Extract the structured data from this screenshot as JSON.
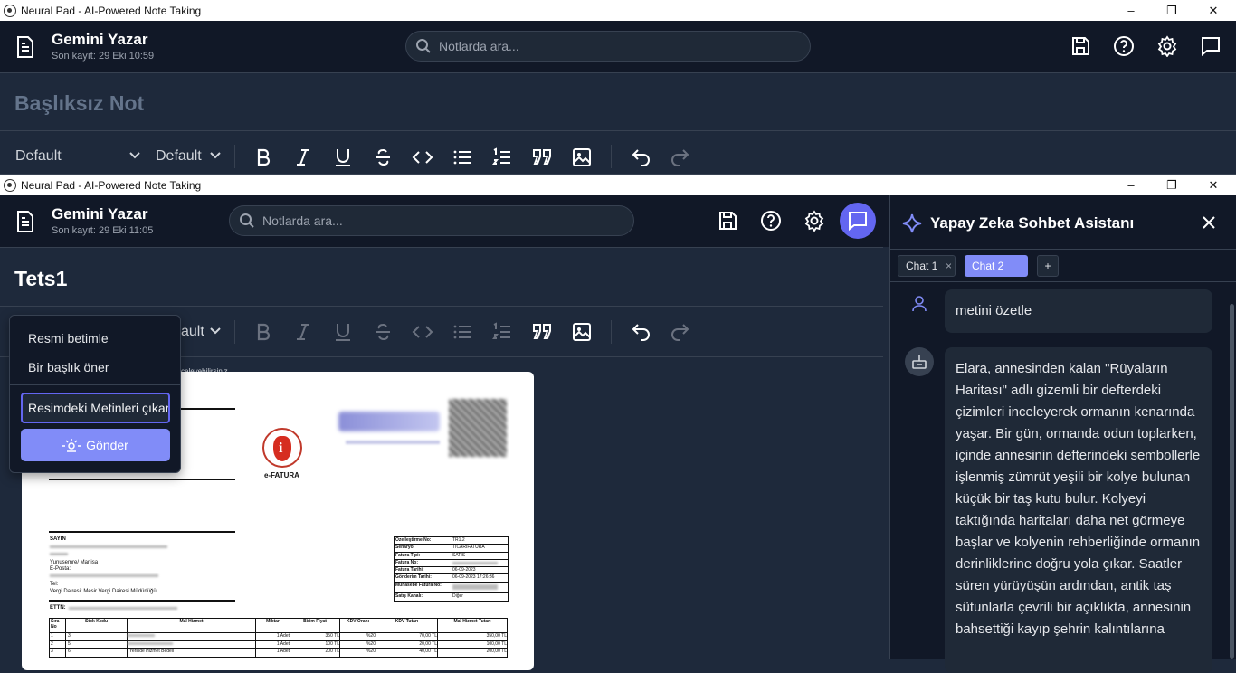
{
  "window": {
    "title": "Neural Pad - AI-Powered Note Taking"
  },
  "back_window": {
    "app_name": "Gemini Yazar",
    "saved": "Son kayıt: 29 Eki 10:59",
    "search_placeholder": "Notlarda ara...",
    "note_title": "Başlıksız Not",
    "font_family": "Default",
    "font_size": "Default"
  },
  "front_window": {
    "app_name": "Gemini Yazar",
    "saved": "Son kayıt: 29 Eki 11:05",
    "search_placeholder": "Notlarda ara...",
    "note_title": "Tets1",
    "font_size_partial": "ault",
    "editor_partial_text": "celeyebilirsiniz."
  },
  "ai_popup": {
    "items": [
      "Resmi betimle",
      "Bir başlık öner"
    ],
    "input_value": "Resimdeki Metinleri çıkar",
    "send_label": "Gönder"
  },
  "chat": {
    "title": "Yapay Zeka Sohbet Asistanı",
    "tabs": [
      {
        "label": "Chat 1",
        "active": false
      },
      {
        "label": "Chat 2",
        "active": true
      }
    ],
    "add_tab": "+",
    "messages": [
      {
        "role": "user",
        "text": "metini özetle"
      },
      {
        "role": "assistant",
        "text": "Elara, annesinden kalan \"Rüyaların Haritası\" adlı gizemli bir defterdeki çizimleri inceleyerek ormanın kenarında yaşar. Bir gün, ormanda odun toplarken, içinde annesinin defterindeki sembollerle işlenmiş zümrüt yeşili bir kolye bulunan küçük bir taş kutu bulur. Kolyeyi taktığında haritaları daha net görmeye başlar ve kolyenin rehberliğinde ormanın derinliklerine doğru yola çıkar. Saatler süren yürüyüşün ardından, antik taş sütunlarla çevrili bir açıklıkta, annesinin bahsettiği kayıp şehrin kalıntılarına"
      }
    ]
  },
  "invoice": {
    "brand": "e-FATURA",
    "sayin": "SAYIN",
    "city": "Yunusemre/ Manisa",
    "email": "E-Posta:",
    "tel": "Tel:",
    "tax_office": "Vergi Dairesi: Mesir Vergi Dairesi Müdürlüğü",
    "ettn": "ETTN:",
    "meta": [
      [
        "Özelleştirme No:",
        "TR1.2"
      ],
      [
        "Senaryo:",
        "TICARIFATURA"
      ],
      [
        "Fatura Tipi:",
        "SATIS"
      ],
      [
        "Fatura No:",
        ""
      ],
      [
        "Fatura Tarihi:",
        "06-09-2023"
      ],
      [
        "Gönderim Tarihi:",
        "06-09-2023 17:26:36"
      ],
      [
        "Muhasebe Fatura No:",
        ""
      ],
      [
        "Satış Kanalı:",
        "Diğer"
      ]
    ],
    "columns": [
      "Sıra No",
      "Stok Kodu",
      "Mal Hizmet",
      "Miktar",
      "Birim Fiyat",
      "KDV Oranı",
      "KDV Tutarı",
      "Mal Hizmet Tutarı"
    ],
    "rows": [
      [
        "1",
        "3",
        "",
        "1 Adet",
        "350 TL",
        "%20",
        "70,00 TL",
        "350,00 TL"
      ],
      [
        "2",
        "5",
        "",
        "1 Adet",
        "100 TL",
        "%20",
        "20,00 TL",
        "100,00 TL"
      ],
      [
        "3",
        "6",
        "Yerinde Hizmet Bedeli",
        "1 Adet",
        "200 TL",
        "%20",
        "40,00 TL",
        "200,00 TL"
      ]
    ]
  },
  "colors": {
    "header_bg": "#111827",
    "body_bg": "#1e293b",
    "accent": "#818cf8",
    "chat_active_button": "#6366f1"
  }
}
